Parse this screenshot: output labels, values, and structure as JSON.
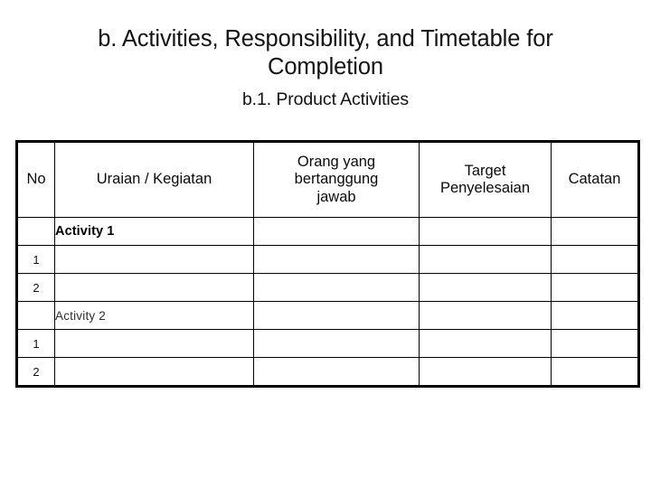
{
  "slide": {
    "title": "b. Activities, Responsibility, and Timetable for\nCompletion",
    "subtitle": "b.1. Product Activities"
  },
  "table": {
    "headers": {
      "no": "No",
      "uraian": "Uraian / Kegiatan",
      "orang_line1": "Orang yang",
      "orang_line2": "bertanggung",
      "orang_line3": "jawab",
      "target_line1": "Target",
      "target_line2": "Penyelesaian",
      "catatan": "Catatan"
    },
    "rows": [
      {
        "no": "",
        "uraian": "Activity 1",
        "orang": "",
        "target": "",
        "catatan": "",
        "style": "strong"
      },
      {
        "no": "1",
        "uraian": "",
        "orang": "",
        "target": "",
        "catatan": "",
        "style": "normal"
      },
      {
        "no": "2",
        "uraian": "",
        "orang": "",
        "target": "",
        "catatan": "",
        "style": "normal"
      },
      {
        "no": "",
        "uraian": "Activity 2",
        "orang": "",
        "target": "",
        "catatan": "",
        "style": "light"
      },
      {
        "no": "1",
        "uraian": "",
        "orang": "",
        "target": "",
        "catatan": "",
        "style": "normal"
      },
      {
        "no": "2",
        "uraian": "",
        "orang": "",
        "target": "",
        "catatan": "",
        "style": "normal"
      }
    ]
  },
  "colors": {
    "background": "#ffffff",
    "text": "#000000",
    "border": "#000000"
  }
}
